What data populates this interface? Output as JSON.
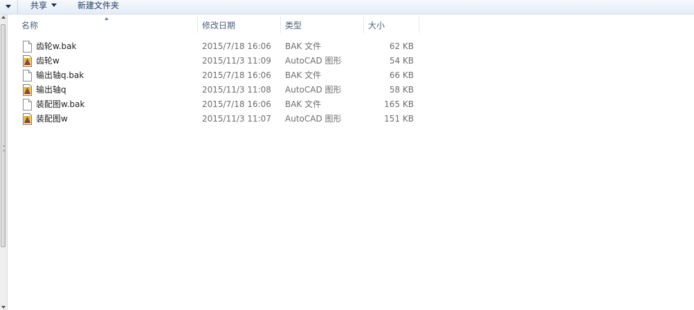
{
  "toolbar": {
    "share_label": "共享",
    "new_folder_label": "新建文件夹"
  },
  "columns": {
    "name": "名称",
    "date": "修改日期",
    "type": "类型",
    "size": "大小"
  },
  "files": [
    {
      "name": "齿轮w.bak",
      "date": "2015/7/18 16:06",
      "type": "BAK 文件",
      "size": "62 KB",
      "icon": "blank-file-icon"
    },
    {
      "name": "齿轮w",
      "date": "2015/11/3 11:09",
      "type": "AutoCAD 图形",
      "size": "54 KB",
      "icon": "autocad-drawing-icon"
    },
    {
      "name": "输出轴q.bak",
      "date": "2015/7/18 16:06",
      "type": "BAK 文件",
      "size": "66 KB",
      "icon": "blank-file-icon"
    },
    {
      "name": "输出轴q",
      "date": "2015/11/3 11:08",
      "type": "AutoCAD 图形",
      "size": "58 KB",
      "icon": "autocad-drawing-icon"
    },
    {
      "name": "装配图w.bak",
      "date": "2015/7/18 16:06",
      "type": "BAK 文件",
      "size": "165 KB",
      "icon": "blank-file-icon"
    },
    {
      "name": "装配图w",
      "date": "2015/11/3 11:07",
      "type": "AutoCAD 图形",
      "size": "151 KB",
      "icon": "autocad-drawing-icon"
    }
  ],
  "colors": {
    "toolbar_text": "#1e395b",
    "header_text": "#4c607a",
    "detail_text": "#6d6d6d"
  }
}
